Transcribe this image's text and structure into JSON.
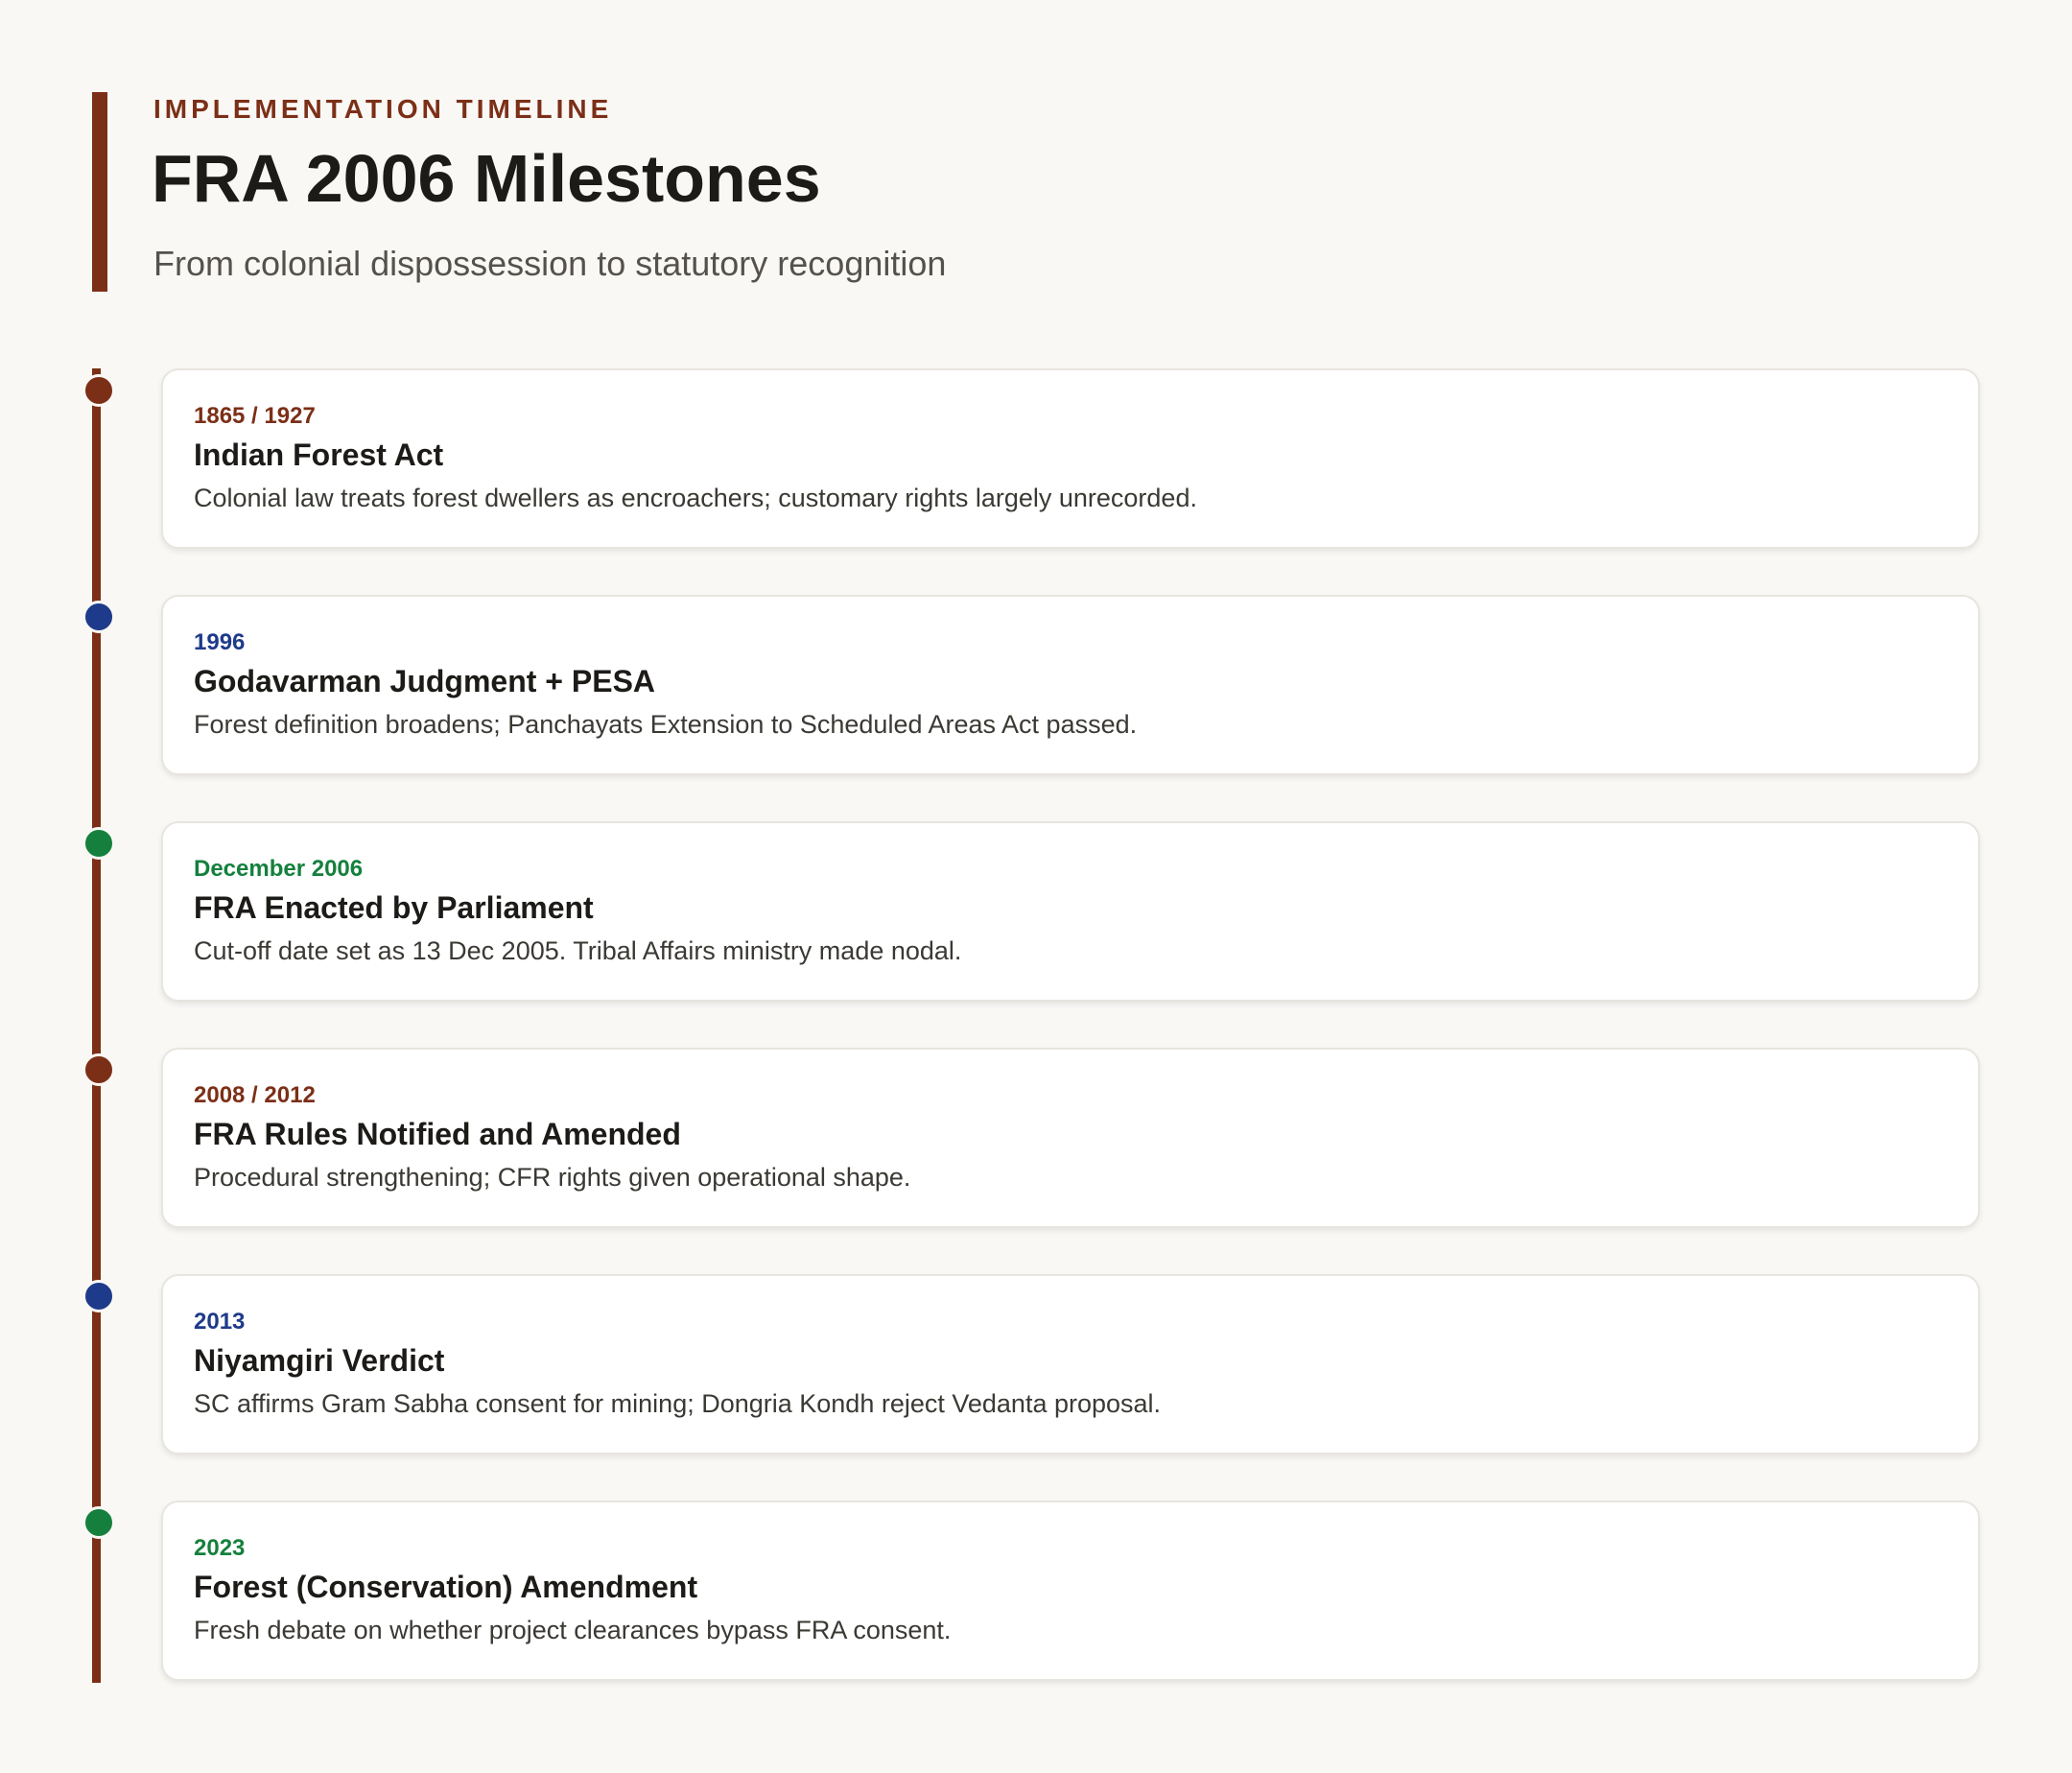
{
  "header": {
    "eyebrow": "IMPLEMENTATION TIMELINE",
    "title": "FRA 2006 Milestones",
    "subtitle": "From colonial dispossession to statutory recognition"
  },
  "colors": {
    "accent": "#7c2f17",
    "rust": "#7c2f17",
    "blue": "#1e3a8a",
    "green": "#15803d"
  },
  "events": [
    {
      "date": "1865 / 1927",
      "title": "Indian Forest Act",
      "description": "Colonial law treats forest dwellers as encroachers; customary rights largely unrecorded.",
      "color": "#7c2f17"
    },
    {
      "date": "1996",
      "title": "Godavarman Judgment + PESA",
      "description": "Forest definition broadens; Panchayats Extension to Scheduled Areas Act passed.",
      "color": "#1e3a8a"
    },
    {
      "date": "December 2006",
      "title": "FRA Enacted by Parliament",
      "description": "Cut-off date set as 13 Dec 2005. Tribal Affairs ministry made nodal.",
      "color": "#15803d"
    },
    {
      "date": "2008 / 2012",
      "title": "FRA Rules Notified and Amended",
      "description": "Procedural strengthening; CFR rights given operational shape.",
      "color": "#7c2f17"
    },
    {
      "date": "2013",
      "title": "Niyamgiri Verdict",
      "description": "SC affirms Gram Sabha consent for mining; Dongria Kondh reject Vedanta proposal.",
      "color": "#1e3a8a"
    },
    {
      "date": "2023",
      "title": "Forest (Conservation) Amendment",
      "description": "Fresh debate on whether project clearances bypass FRA consent.",
      "color": "#15803d"
    }
  ]
}
